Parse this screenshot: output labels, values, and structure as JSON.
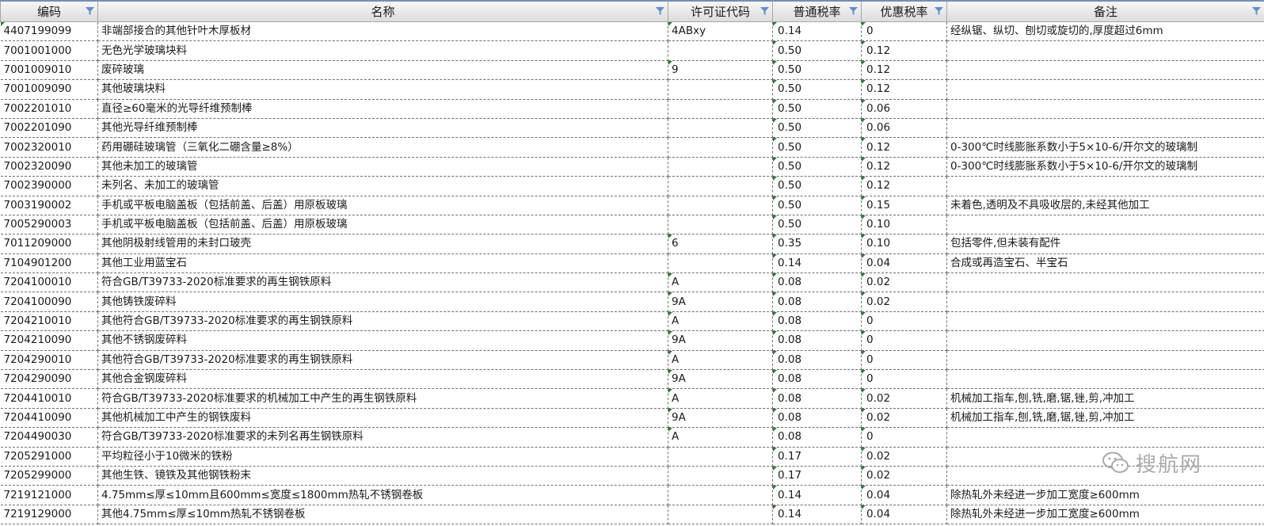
{
  "header": {
    "columns": [
      "编码",
      "名称",
      "许可证代码",
      "普通税率",
      "优惠税率",
      "备注"
    ]
  },
  "rows": [
    [
      "4407199099",
      "非端部接合的其他针叶木厚板材",
      "4ABxy",
      "0.14",
      "0",
      "经纵锯、纵切、刨切或旋切的,厚度超过6mm"
    ],
    [
      "7001001000",
      "无色光学玻璃块料",
      "",
      "0.50",
      "0.12",
      ""
    ],
    [
      "7001009010",
      "废碎玻璃",
      "9",
      "0.50",
      "0.12",
      ""
    ],
    [
      "7001009090",
      "其他玻璃块料",
      "",
      "0.50",
      "0.12",
      ""
    ],
    [
      "7002201010",
      "直径≥60毫米的光导纤维预制棒",
      "",
      "0.50",
      "0.06",
      ""
    ],
    [
      "7002201090",
      "其他光导纤维预制棒",
      "",
      "0.50",
      "0.06",
      ""
    ],
    [
      "7002320010",
      "药用硼硅玻璃管（三氧化二硼含量≥8%）",
      "",
      "0.50",
      "0.12",
      "0-300℃时线膨胀系数小于5×10-6/开尔文的玻璃制"
    ],
    [
      "7002320090",
      "其他未加工的玻璃管",
      "",
      "0.50",
      "0.12",
      "0-300℃时线膨胀系数小于5×10-6/开尔文的玻璃制"
    ],
    [
      "7002390000",
      "未列名、未加工的玻璃管",
      "",
      "0.50",
      "0.12",
      ""
    ],
    [
      "7003190002",
      "手机或平板电脑盖板（包括前盖、后盖）用原板玻璃",
      "",
      "0.50",
      "0.15",
      "未着色,透明及不具吸收层的,未经其他加工"
    ],
    [
      "7005290003",
      "手机或平板电脑盖板（包括前盖、后盖）用原板玻璃",
      "",
      "0.50",
      "0.10",
      ""
    ],
    [
      "7011209000",
      "其他阴极射线管用的未封口玻壳",
      "6",
      "0.35",
      "0.10",
      "包括零件,但未装有配件"
    ],
    [
      "7104901200",
      "其他工业用蓝宝石",
      "",
      "0.14",
      "0.04",
      "合成或再造宝石、半宝石"
    ],
    [
      "7204100010",
      "符合GB/T39733-2020标准要求的再生钢铁原料",
      "A",
      "0.08",
      "0.02",
      ""
    ],
    [
      "7204100090",
      "其他铸铁废碎料",
      "9A",
      "0.08",
      "0.02",
      ""
    ],
    [
      "7204210010",
      "其他符合GB/T39733-2020标准要求的再生钢铁原料",
      "A",
      "0.08",
      "0",
      ""
    ],
    [
      "7204210090",
      "其他不锈钢废碎料",
      "9A",
      "0.08",
      "0",
      ""
    ],
    [
      "7204290010",
      "其他符合GB/T39733-2020标准要求的再生钢铁原料",
      "A",
      "0.08",
      "0",
      ""
    ],
    [
      "7204290090",
      "其他合金钢废碎料",
      "9A",
      "0.08",
      "0",
      ""
    ],
    [
      "7204410010",
      "符合GB/T39733-2020标准要求的机械加工中产生的再生钢铁原料",
      "A",
      "0.08",
      "0.02",
      "机械加工指车,刨,铣,磨,锯,锉,剪,冲加工"
    ],
    [
      "7204410090",
      "其他机械加工中产生的钢铁废料",
      "9A",
      "0.08",
      "0.02",
      "机械加工指车,刨,铣,磨,锯,锉,剪,冲加工"
    ],
    [
      "7204490030",
      "符合GB/T39733-2020标准要求的未列名再生钢铁原料",
      "A",
      "0.08",
      "0",
      ""
    ],
    [
      "7205291000",
      "平均粒径小于10微米的铁粉",
      "",
      "0.17",
      "0.02",
      ""
    ],
    [
      "7205299000",
      "其他生铁、镜铁及其他钢铁粉末",
      "",
      "0.17",
      "0.02",
      ""
    ],
    [
      "7219121000",
      "4.75mm≤厚≤10mm且600mm≤宽度≤1800mm热轧不锈钢卷板",
      "",
      "0.14",
      "0.04",
      "除热轧外未经进一步加工宽度≥600mm"
    ],
    [
      "7219129000",
      "其他4.75mm≤厚≤10mm热轧不锈钢卷板",
      "",
      "0.14",
      "0.04",
      "除热轧外未经进一步加工宽度≥600mm"
    ]
  ],
  "watermark": {
    "text": "搜航网",
    "icon": "wechat-icon"
  },
  "colors": {
    "header_top": "#6f8fb8",
    "filter": "#5b8fd6",
    "triangle": "#2e7d32",
    "watermark": "#ababab"
  }
}
